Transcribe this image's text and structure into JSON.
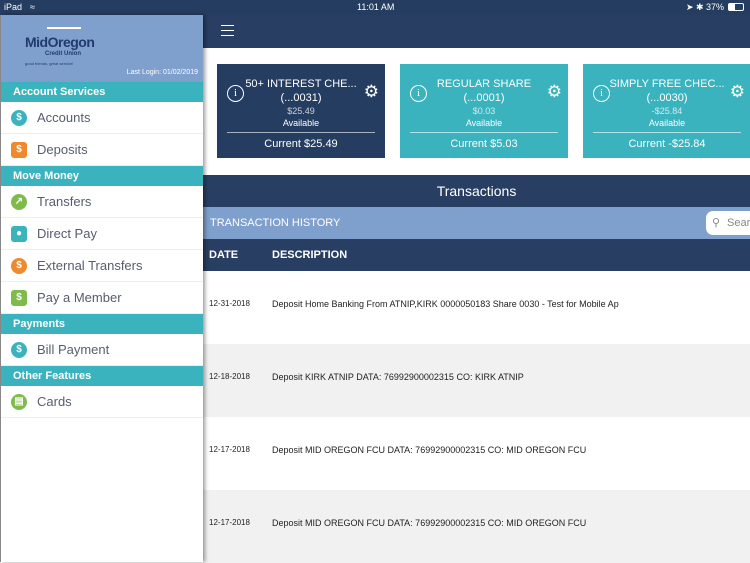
{
  "status": {
    "device": "iPad",
    "time": "11:01 AM",
    "battery": "37%"
  },
  "sidebar": {
    "logo": {
      "line1": "MidOregon",
      "line2": "Credit Union",
      "tagline": "good friends, great service!"
    },
    "last_login": "Last Login:  01/02/2019",
    "sections": [
      {
        "title": "Account Services",
        "items": [
          {
            "label": "Accounts",
            "icon": "money-bag-icon",
            "color": "#3ab3bf"
          },
          {
            "label": "Deposits",
            "icon": "house-dollar-icon",
            "color": "#f0892b"
          }
        ]
      },
      {
        "title": "Move Money",
        "items": [
          {
            "label": "Transfers",
            "icon": "transfer-arrows-icon",
            "color": "#7dbb4a"
          },
          {
            "label": "Direct Pay",
            "icon": "hand-coin-icon",
            "color": "#3ab3bf"
          },
          {
            "label": "External Transfers",
            "icon": "external-transfer-icon",
            "color": "#f0892b"
          },
          {
            "label": "Pay a Member",
            "icon": "hand-cash-icon",
            "color": "#7dbb4a"
          }
        ]
      },
      {
        "title": "Payments",
        "items": [
          {
            "label": "Bill Payment",
            "icon": "bill-icon",
            "color": "#3ab3bf"
          }
        ]
      },
      {
        "title": "Other Features",
        "items": [
          {
            "label": "Cards",
            "icon": "cards-icon",
            "color": "#7dbb4a"
          }
        ]
      }
    ]
  },
  "accounts": [
    {
      "name": "50+ INTEREST CHE...",
      "number": "(...0031)",
      "balance": "$25.49",
      "available_label": "Available",
      "current": "Current $25.49",
      "color": "#263d62"
    },
    {
      "name": "REGULAR SHARE",
      "number": "(...0001)",
      "balance": "$0.03",
      "available_label": "Available",
      "current": "Current $5.03",
      "color": "#3ab3bf"
    },
    {
      "name": "SIMPLY FREE CHEC...",
      "number": "(...0030)",
      "balance": "-$25.84",
      "available_label": "Available",
      "current": "Current -$25.84",
      "color": "#3ab3bf"
    }
  ],
  "transactions": {
    "title": "Transactions",
    "history_label": "TRANSACTION HISTORY",
    "search_placeholder": "Search",
    "columns": [
      "DATE",
      "DESCRIPTION"
    ],
    "rows": [
      {
        "date": "12-31-2018",
        "description": "Deposit Home Banking From ATNIP,KIRK 0000050183 Share 0030 - Test for Mobile Ap"
      },
      {
        "date": "12-18-2018",
        "description": "Deposit KIRK ATNIP DATA: 76992900002315 CO: KIRK ATNIP"
      },
      {
        "date": "12-17-2018",
        "description": "Deposit MID OREGON FCU DATA: 76992900002315 CO: MID OREGON FCU"
      },
      {
        "date": "12-17-2018",
        "description": "Deposit MID OREGON FCU DATA: 76992900002315 CO: MID OREGON FCU"
      }
    ]
  }
}
